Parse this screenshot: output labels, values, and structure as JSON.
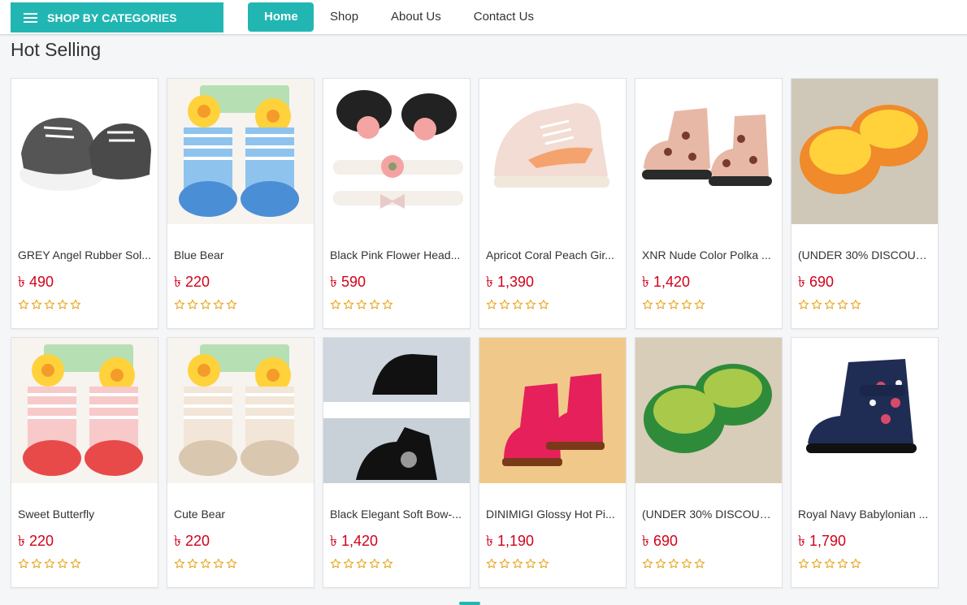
{
  "header": {
    "categories_label": "SHOP BY CATEGORIES",
    "nav": [
      "Home",
      "Shop",
      "About Us",
      "Contact Us"
    ],
    "active_nav": "Home",
    "accent_color": "#22b6b3"
  },
  "section": {
    "title": "Hot Selling"
  },
  "price_color": "#d0021b",
  "star_color": "#e8a317",
  "products": [
    {
      "name": "GREY Angel Rubber Sol...",
      "price": "৳ 490",
      "rating": 0,
      "image": "grey-sneakers"
    },
    {
      "name": "Blue Bear",
      "price": "৳ 220",
      "rating": 0,
      "image": "blue-bear-socks"
    },
    {
      "name": "Black Pink Flower Head...",
      "price": "৳ 590",
      "rating": 0,
      "image": "flower-shoes-headband"
    },
    {
      "name": "Apricot Coral Peach Gir...",
      "price": "৳ 1,390",
      "rating": 0,
      "image": "peach-sneaker"
    },
    {
      "name": "XNR Nude Color Polka ...",
      "price": "৳ 1,420",
      "rating": 0,
      "image": "polka-boots"
    },
    {
      "name": "(UNDER 30% DISCOUN...",
      "price": "৳ 690",
      "rating": 0,
      "image": "yellow-slippers"
    },
    {
      "name": "Sweet Butterfly",
      "price": "৳ 220",
      "rating": 0,
      "image": "butterfly-socks"
    },
    {
      "name": "Cute Bear",
      "price": "৳ 220",
      "rating": 0,
      "image": "bear-socks"
    },
    {
      "name": "Black Elegant Soft Bow-...",
      "price": "৳ 1,420",
      "rating": 0,
      "image": "black-bow-boots"
    },
    {
      "name": "DINIMIGI Glossy Hot Pi...",
      "price": "৳ 1,190",
      "rating": 0,
      "image": "pink-glossy-boots"
    },
    {
      "name": "(UNDER 30% DISCOUN...",
      "price": "৳ 690",
      "rating": 0,
      "image": "green-slippers"
    },
    {
      "name": "Royal Navy Babylonian ...",
      "price": "৳ 1,790",
      "rating": 0,
      "image": "navy-floral-boots"
    }
  ]
}
